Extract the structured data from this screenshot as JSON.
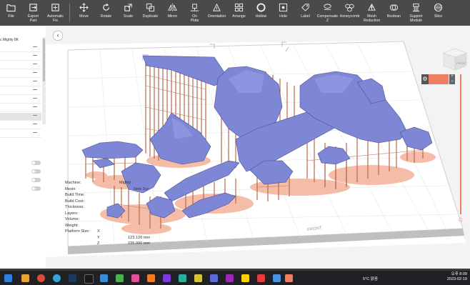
{
  "toolbar": {
    "items": [
      {
        "label": "File",
        "icon": "folder-icon"
      },
      {
        "label": "Export\nPart",
        "icon": "export-icon"
      },
      {
        "label": "Automatic\nFix",
        "icon": "automatic-fix-icon"
      },
      {
        "label": "Move",
        "icon": "move-icon"
      },
      {
        "label": "Rotate",
        "icon": "rotate-icon"
      },
      {
        "label": "Scale",
        "icon": "scale-icon"
      },
      {
        "label": "Duplicate",
        "icon": "duplicate-icon"
      },
      {
        "label": "Mirror",
        "icon": "mirror-icon"
      },
      {
        "label": "On\nPlate",
        "icon": "on-plate-icon"
      },
      {
        "label": "Orientation",
        "icon": "orientation-icon"
      },
      {
        "label": "Arrange",
        "icon": "arrange-icon"
      },
      {
        "label": "Hollow",
        "icon": "hollow-icon"
      },
      {
        "label": "Hole",
        "icon": "hole-icon"
      },
      {
        "label": "Label",
        "icon": "label-icon"
      },
      {
        "label": "Compensate\nZ",
        "icon": "compensate-icon"
      },
      {
        "label": "Honeycomb",
        "icon": "honeycomb-icon"
      },
      {
        "label": "Mesh\nReduction",
        "icon": "mesh-reduction-icon"
      },
      {
        "label": "Boolean",
        "icon": "boolean-icon"
      },
      {
        "label": "Support\nModule",
        "icon": "support-icon"
      },
      {
        "label": "Slice",
        "icon": "slice-icon"
      }
    ]
  },
  "left_panel": {
    "machine_name": "c Mighty 8K"
  },
  "info": {
    "machine_label": "Machine:",
    "machine_value": "Mighty",
    "resin_label": "Resin:",
    "resin_value": "New Scr",
    "build_time_label": "Build Time:",
    "build_cost_label": "Build Cost:",
    "thickness_label": "Thickness:",
    "layers_label": "Layers:",
    "volume_label": "Volume:",
    "weight_label": "Weight:",
    "platform_label": "Platform Size:",
    "axis_x": "X",
    "axis_y": "Y",
    "axis_z": "Z",
    "y_value": "123.120 mm",
    "z_value": "235.000 mm"
  },
  "viewport": {
    "front_label": "FRONT",
    "cube_label": "FRONT"
  },
  "taskbar": {
    "weather": "5°C  맑음",
    "time": "오후 8:09",
    "date": "2023-02-19"
  },
  "colors": {
    "toolbar_bg": "#4a4a4a",
    "model": "#7e86d6",
    "supports": "#b8684c",
    "accent": "#ef7e63"
  }
}
